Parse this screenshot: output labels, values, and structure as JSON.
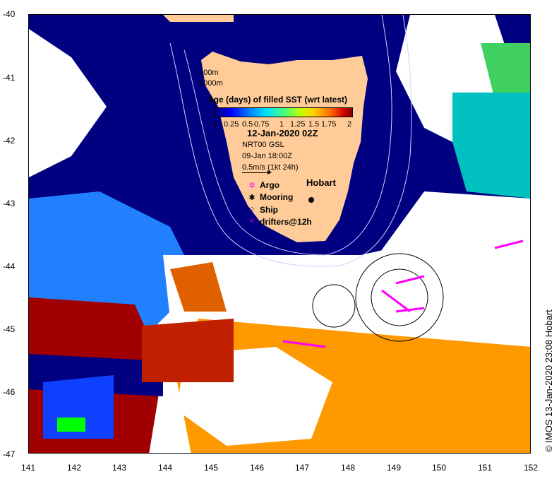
{
  "map": {
    "lat_ticks": [
      "-40",
      "-41",
      "-42",
      "-43",
      "-44",
      "-45",
      "-46",
      "-47"
    ],
    "lon_ticks": [
      "141",
      "142",
      "143",
      "144",
      "145",
      "146",
      "147",
      "148",
      "149",
      "150",
      "151",
      "152"
    ],
    "lon_range": [
      141,
      152
    ],
    "lat_range": [
      -47,
      -40
    ],
    "land_color": "#ffcc99",
    "no_data_color": "#ffffff"
  },
  "overlay": {
    "contour_200": "200m",
    "contour_1000": "1000m",
    "colorbar_title": "Age (days) of filled SST (wrt latest)",
    "colorbar_ticks": [
      "0",
      "0.25",
      "0.5",
      "0.75",
      "1",
      "1.25",
      "1.5",
      "1.75",
      "2"
    ],
    "date": "12-Jan-2020 02Z",
    "model": "NRT00 GSL",
    "model_time": "09-Jan 18:00Z",
    "scale": "0.5m/s (1kt 24h)",
    "city": "Hobart"
  },
  "legend": [
    {
      "symbol": "✲",
      "color": "#ff00ff",
      "label": "Argo"
    },
    {
      "symbol": "✱",
      "color": "#000000",
      "label": "Mooring"
    },
    {
      "symbol": "○",
      "color": "#000000",
      "label": "Ship"
    },
    {
      "symbol": "<",
      "color": "#ff00ff",
      "label": "drifters@12h"
    }
  ],
  "credit": "© IMOS 13-Jan-2020 23:08 Hobart",
  "age_colors": [
    "#000080",
    "#0000ff",
    "#0080ff",
    "#00e0ff",
    "#40ff80",
    "#c0ff00",
    "#ffd000",
    "#ff6000",
    "#d00000",
    "#800000"
  ]
}
